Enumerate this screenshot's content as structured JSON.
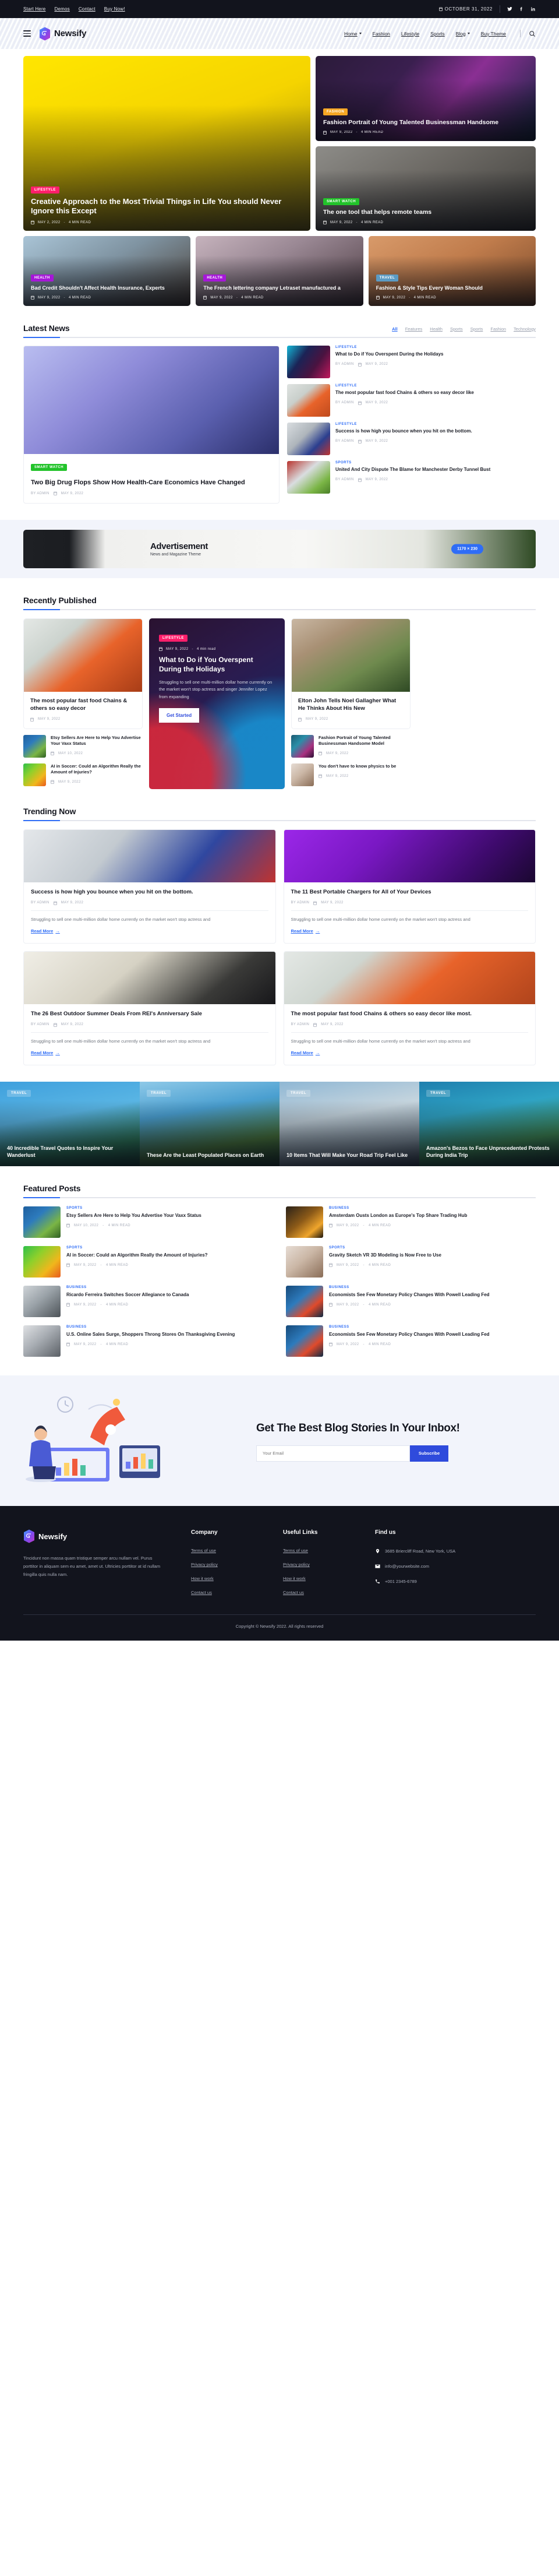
{
  "topbar": {
    "links": [
      "Start Here",
      "Demos",
      "Contact",
      "Buy Now!"
    ],
    "date": "OCTOBER 31, 2022",
    "socials": [
      "twitter-icon",
      "facebook-icon",
      "linkedin-icon"
    ]
  },
  "nav": {
    "brand": "Newsify",
    "menu": [
      {
        "label": "Home",
        "caret": true
      },
      {
        "label": "Fashion",
        "caret": false
      },
      {
        "label": "Lifestyle",
        "caret": false
      },
      {
        "label": "Sports",
        "caret": false
      },
      {
        "label": "Blog",
        "caret": true
      },
      {
        "label": "Buy Theme",
        "caret": false
      }
    ]
  },
  "hero": {
    "main": {
      "tag": "LIFESTYLE",
      "title": "Creative Approach to the Most Trivial Things in Life You should Never Ignore this Except",
      "date": "MAY 2, 2022",
      "read": "4 MIN READ"
    },
    "side": [
      {
        "tag": "FASHION",
        "title": "Fashion Portrait of Young Talented Businessman Handsome",
        "date": "MAY 9, 2022",
        "read": "4 MIN READ"
      },
      {
        "tag": "SMART WATCH",
        "title": "The one tool that helps remote teams",
        "date": "MAY 9, 2022",
        "read": "4 MIN READ"
      }
    ]
  },
  "trio": [
    {
      "tag": "HEALTH",
      "title": "Bad Credit Shouldn't Affect Health Insurance, Experts",
      "date": "MAY 9, 2022",
      "read": "4 MIN READ"
    },
    {
      "tag": "HEALTH",
      "title": "The French lettering company Letraset manufactured a",
      "date": "MAY 9, 2022",
      "read": "4 MIN READ"
    },
    {
      "tag": "TRAVEL",
      "title": "Fashion & Style Tips Every Woman Should",
      "date": "MAY 9, 2022",
      "read": "4 MIN READ"
    }
  ],
  "latest": {
    "title": "Latest News",
    "filters": [
      "All",
      "Features",
      "Health",
      "Sports",
      "Sports",
      "Fashion",
      "Technology"
    ],
    "active_filter": "All",
    "main": {
      "tag": "SMART WATCH",
      "title": "Two Big Drug Flops Show How Health-Care Economics Have Changed",
      "author": "BY ADMIN",
      "date": "MAY 9, 2022"
    },
    "side": [
      {
        "cat": "LIFESTYLE",
        "title": "What to Do if You Overspent During the Holidays",
        "author": "BY ADMIN",
        "date": "MAY 9, 2022"
      },
      {
        "cat": "LIFESTYLE",
        "title": "The most popular fast food Chains & others so easy decor like",
        "author": "BY ADMIN",
        "date": "MAY 9, 2022"
      },
      {
        "cat": "LIFESTYLE",
        "title": "Success is how high you bounce when you hit on the bottom.",
        "author": "BY ADMIN",
        "date": "MAY 9, 2022"
      },
      {
        "cat": "SPORTS",
        "title": "United And City Dispute The Blame for Manchester Derby Tunnel Bust",
        "author": "BY ADMIN",
        "date": "MAY 9, 2022"
      }
    ]
  },
  "ad": {
    "title": "Advertisement",
    "subtitle": "News and Magazine Theme",
    "size": "1170 × 230"
  },
  "recently": {
    "title": "Recently Published",
    "left": {
      "card": {
        "title": "The most popular fast food Chains & others so easy decor",
        "date": "MAY 9, 2022"
      },
      "minis": [
        {
          "title": "Etsy Sellers Are Here to Help You Advertise Your Vaxx Status",
          "date": "MAY 10, 2022"
        },
        {
          "title": "AI in Soccer: Could an Algorithm Really the Amount of Injuries?",
          "date": "MAY 9, 2022"
        }
      ]
    },
    "center": {
      "tag": "LIFESTYLE",
      "date": "MAY 9, 2022",
      "read": "4 min read",
      "title": "What to Do if You Overspent During the Holidays",
      "desc": "Struggling to sell one multi-million dollar home currently on the market won't stop actress and singer Jennifer Lopez from expanding",
      "button": "Get Started"
    },
    "right": {
      "card": {
        "title": "Elton John Tells Noel Gallagher What He Thinks About His New",
        "date": "MAY 9, 2022"
      },
      "minis": [
        {
          "title": "Fashion Portrait of Young Talented Businessman Handsome Model",
          "date": "MAY 9, 2022"
        },
        {
          "title": "You don't have to know physics to be",
          "date": "MAY 9, 2022"
        }
      ]
    }
  },
  "trending": {
    "title": "Trending Now",
    "cards": [
      {
        "title": "Success is how high you bounce when you hit on the bottom.",
        "author": "BY ADMIN",
        "date": "MAY 9, 2022",
        "desc": "Struggling to sell one multi-million dollar home currently on the market won't stop actress and",
        "link": "Read More"
      },
      {
        "title": "The 11 Best Portable Chargers for All of Your Devices",
        "author": "BY ADMIN",
        "date": "MAY 9, 2022",
        "desc": "Struggling to sell one multi-million dollar home currently on the market won't stop actress and",
        "link": "Read More"
      },
      {
        "title": "The 26 Best Outdoor Summer Deals From REI's Anniversary Sale",
        "author": "BY ADMIN",
        "date": "MAY 9, 2022",
        "desc": "Struggling to sell one multi-million dollar home currently on the market won't stop actress and",
        "link": "Read More"
      },
      {
        "title": "The most popular fast food Chains & others so easy decor like most.",
        "author": "BY ADMIN",
        "date": "MAY 9, 2022",
        "desc": "Struggling to sell one multi-million dollar home currently on the market won't stop actress and",
        "link": "Read More"
      }
    ]
  },
  "travel": [
    {
      "tag": "TRAVEL",
      "title": "40 Incredible Travel Quotes to Inspire Your Wanderlust"
    },
    {
      "tag": "TRAVEL",
      "title": "These Are the Least Populated Places on Earth"
    },
    {
      "tag": "TRAVEL",
      "title": "10 Items That Will Make Your Road Trip Feel Like"
    },
    {
      "tag": "TRAVEL",
      "title": "Amazon's Bezos to Face Unprecedented Protests During India Trip"
    }
  ],
  "featured": {
    "title": "Featured Posts",
    "items": [
      {
        "cat": "SPORTS",
        "title": "Etsy Sellers Are Here to Help You Advertise Your Vaxx Status",
        "date": "MAY 10, 2022",
        "read": "4 MIN READ"
      },
      {
        "cat": "BUSINESS",
        "title": "Amsterdam Ousts London as Europe's Top Share Trading Hub",
        "date": "MAY 9, 2022",
        "read": "4 MIN READ"
      },
      {
        "cat": "SPORTS",
        "title": "AI in Soccer: Could an Algorithm Really the Amount of Injuries?",
        "date": "MAY 9, 2022",
        "read": "4 MIN READ"
      },
      {
        "cat": "SPORTS",
        "title": "Gravity Sketch VR 3D Modeling is Now Free to Use",
        "date": "MAY 9, 2022",
        "read": "4 MIN READ"
      },
      {
        "cat": "BUSINESS",
        "title": "Ricardo Ferreira Switches Soccer Allegiance to Canada",
        "date": "MAY 9, 2022",
        "read": "4 MIN READ"
      },
      {
        "cat": "BUSINESS",
        "title": "Economists See Few Monetary Policy Changes With Powell Leading Fed",
        "date": "MAY 9, 2022",
        "read": "4 MIN READ"
      },
      {
        "cat": "BUSINESS",
        "title": "U.S. Online Sales Surge, Shoppers Throng Stores On Thanksgiving Evening",
        "date": "MAY 9, 2022",
        "read": "4 MIN READ"
      },
      {
        "cat": "BUSINESS",
        "title": "Economists See Few Monetary Policy Changes With Powell Leading Fed",
        "date": "MAY 9, 2022",
        "read": "4 MIN READ"
      }
    ]
  },
  "newsletter": {
    "title": "Get The Best Blog Stories In Your Inbox!",
    "placeholder": "Your Email",
    "button": "Subscribe"
  },
  "footer": {
    "brand": "Newsify",
    "desc": "Tincidunt non massa quam tristique semper arcu nullam vel. Purus porttitor in aliquam sem eu amet, amet ut. Ultricies porttitor at id nullam fringilla quis nulla nam.",
    "col1": {
      "head": "Company",
      "links": [
        "Terms of use",
        "Privacy policy",
        "How it work",
        "Contact us"
      ]
    },
    "col2": {
      "head": "Useful Links",
      "links": [
        "Terms of use",
        "Privacy policy",
        "How it work",
        "Contact us"
      ]
    },
    "find": {
      "head": "Find us",
      "address": "3685 Briercliff Road, New York, USA",
      "email": "info@yourwebsite.com",
      "phone": "+001 2345-6789"
    },
    "copyright": "Copyright © Newsify 2022. All rights reserved"
  },
  "colors": {
    "accent": "#2f6df6",
    "dark": "#12141d",
    "pink": "#ff1f6b",
    "orange": "#f5a623",
    "green": "#22c32a",
    "purple": "#a617d8"
  }
}
